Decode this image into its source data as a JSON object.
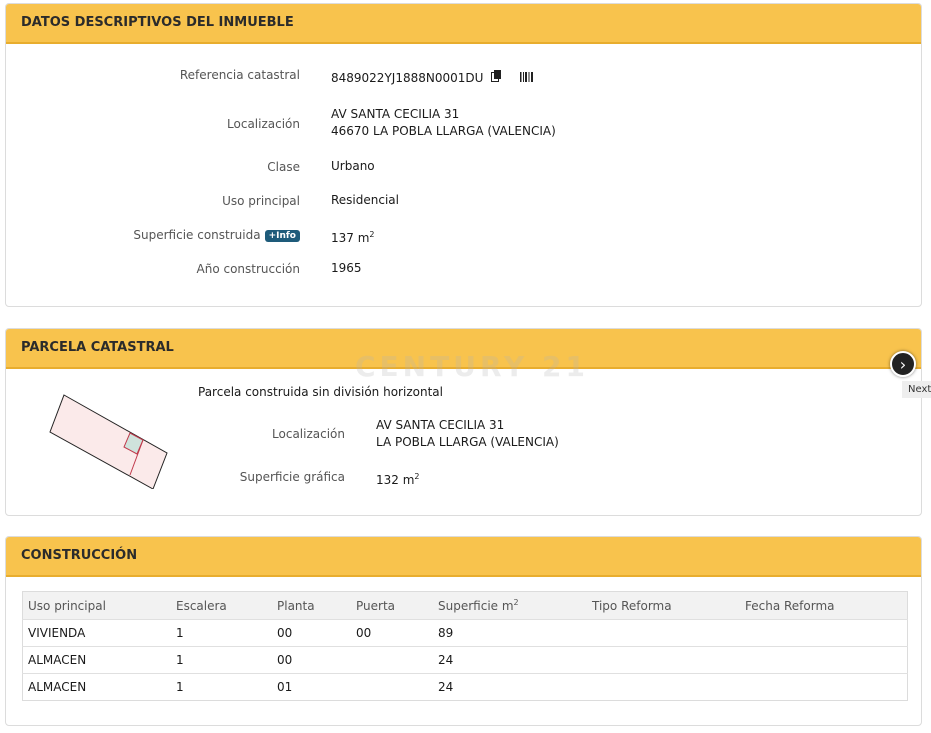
{
  "descriptivos": {
    "title": "DATOS DESCRIPTIVOS DEL INMUEBLE",
    "referencia_label": "Referencia catastral",
    "referencia_value": "8489022YJ1888N0001DU",
    "localizacion_label": "Localización",
    "localizacion_line1": "AV SANTA CECILIA 31",
    "localizacion_line2": "46670 LA POBLA LLARGA (VALENCIA)",
    "clase_label": "Clase",
    "clase_value": "Urbano",
    "uso_label": "Uso principal",
    "uso_value": "Residencial",
    "superficie_label": "Superficie construida",
    "info_badge": "+Info",
    "superficie_value": "137 m",
    "superficie_exp": "2",
    "anio_label": "Año construcción",
    "anio_value": "1965"
  },
  "parcela": {
    "title": "PARCELA CATASTRAL",
    "descripcion": "Parcela construida sin división horizontal",
    "localizacion_label": "Localización",
    "localizacion_line1": "AV SANTA CECILIA 31",
    "localizacion_line2": "LA POBLA LLARGA (VALENCIA)",
    "superficie_label": "Superficie gráfica",
    "superficie_value": "132 m",
    "superficie_exp": "2"
  },
  "watermark": "CENTURY 21",
  "next": {
    "icon": "chevron-right-icon",
    "label": "Next"
  },
  "construccion": {
    "title": "CONSTRUCCIÓN",
    "headers": [
      "Uso principal",
      "Escalera",
      "Planta",
      "Puerta",
      "Superficie m",
      "Tipo Reforma",
      "Fecha Reforma"
    ],
    "superficie_exp": "2",
    "rows": [
      [
        "VIVIENDA",
        "1",
        "00",
        "00",
        "89",
        "",
        ""
      ],
      [
        "ALMACEN",
        "1",
        "00",
        "",
        "24",
        "",
        ""
      ],
      [
        "ALMACEN",
        "1",
        "01",
        "",
        "24",
        "",
        ""
      ]
    ]
  },
  "colors": {
    "header": "#f8c34d",
    "badge": "#1e5b7a",
    "plot_fill": "#fbeaea",
    "plot_edge": "#c0394b",
    "building_fill": "#cfe3dc"
  }
}
